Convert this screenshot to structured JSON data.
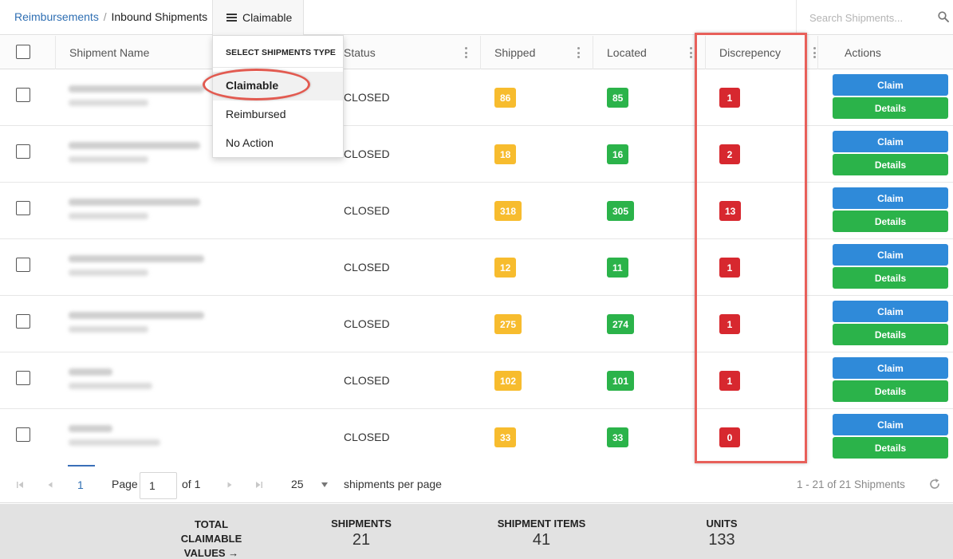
{
  "breadcrumb": {
    "parent": "Reimbursements",
    "separator": "/",
    "current": "Inbound Shipments"
  },
  "type_selector": {
    "label": "Claimable"
  },
  "search": {
    "placeholder": "Search Shipments..."
  },
  "dropdown": {
    "header": "SELECT SHIPMENTS TYPE",
    "options": [
      "Claimable",
      "Reimbursed",
      "No Action"
    ],
    "selected": "Claimable"
  },
  "columns": {
    "name": "Shipment Name",
    "status": "Status",
    "shipped": "Shipped",
    "located": "Located",
    "discrepancy": "Discrepency",
    "actions": "Actions"
  },
  "rows": [
    {
      "status": "CLOSED",
      "shipped": "86",
      "located": "85",
      "discrepancy": "1",
      "claim": "Claim",
      "details": "Details"
    },
    {
      "status": "CLOSED",
      "shipped": "18",
      "located": "16",
      "discrepancy": "2",
      "claim": "Claim",
      "details": "Details"
    },
    {
      "status": "CLOSED",
      "shipped": "318",
      "located": "305",
      "discrepancy": "13",
      "claim": "Claim",
      "details": "Details"
    },
    {
      "status": "CLOSED",
      "shipped": "12",
      "located": "11",
      "discrepancy": "1",
      "claim": "Claim",
      "details": "Details"
    },
    {
      "status": "CLOSED",
      "shipped": "275",
      "located": "274",
      "discrepancy": "1",
      "claim": "Claim",
      "details": "Details"
    },
    {
      "status": "CLOSED",
      "shipped": "102",
      "located": "101",
      "discrepancy": "1",
      "claim": "Claim",
      "details": "Details"
    },
    {
      "status": "CLOSED",
      "shipped": "33",
      "located": "33",
      "discrepancy": "0",
      "claim": "Claim",
      "details": "Details"
    }
  ],
  "pagination": {
    "current_page": "1",
    "page_label": "Page",
    "page_input": "1",
    "of_label": "of 1",
    "per_page": "25",
    "per_page_label": "shipments per page",
    "count_text": "1 - 21 of 21 Shipments"
  },
  "totals": {
    "label_lines": [
      "TOTAL",
      "CLAIMABLE",
      "VALUES →"
    ],
    "shipments_label": "SHIPMENTS",
    "shipments_value": "21",
    "items_label": "SHIPMENT ITEMS",
    "items_value": "41",
    "units_label": "UNITS",
    "units_value": "133"
  },
  "colors": {
    "link": "#2f6fb3",
    "shipped_badge": "#f7bc2e",
    "located_badge": "#2bb34a",
    "discrepancy_badge": "#d7282f",
    "claim_button": "#2f8ad9",
    "details_button": "#2bb34a",
    "annotation": "#e8605a"
  }
}
